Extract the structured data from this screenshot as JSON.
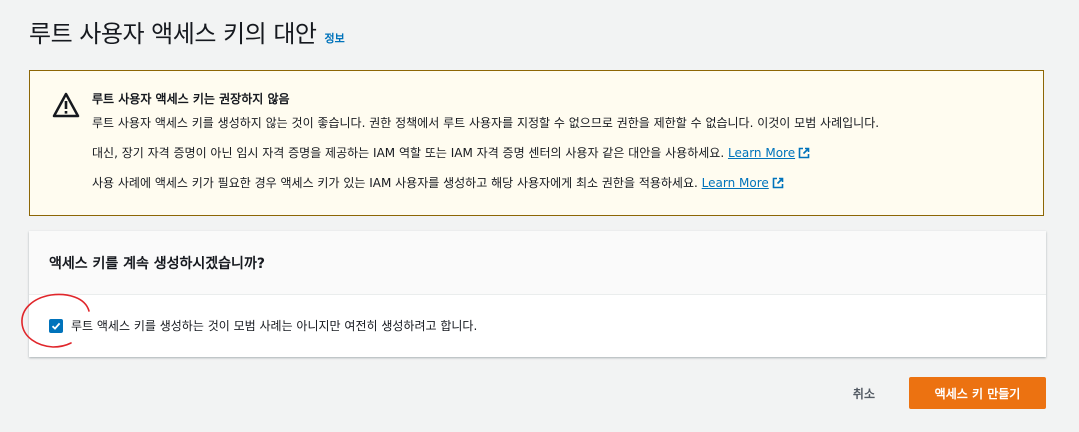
{
  "header": {
    "title": "루트 사용자 액세스 키의 대안",
    "info_link": "정보"
  },
  "warning": {
    "title": "루트 사용자 액세스 키는 권장하지 않음",
    "line1": "루트 사용자 액세스 키를 생성하지 않는 것이 좋습니다. 권한 정책에서 루트 사용자를 지정할 수 없으므로 권한을 제한할 수 없습니다. 이것이 모범 사례입니다.",
    "line2": "대신, 장기 자격 증명이 아닌 임시 자격 증명을 제공하는 IAM 역할 또는 IAM 자격 증명 센터의 사용자 같은 대안을 사용하세요.",
    "line3": "사용 사례에 액세스 키가 필요한 경우 액세스 키가 있는 IAM 사용자를 생성하고 해당 사용자에게 최소 권한을 적용하세요.",
    "learn_more": "Learn More",
    "icon": "warning-triangle-icon"
  },
  "panel": {
    "title": "액세스 키를 계속 생성하시겠습니까?",
    "checkbox_label": "루트 액세스 키를 생성하는 것이 모범 사례는 아니지만 여전히 생성하려고 합니다.",
    "checkbox_checked": true
  },
  "footer": {
    "cancel": "취소",
    "create": "액세스 키 만들기"
  },
  "colors": {
    "accent": "#0073bb",
    "primary": "#ec7211",
    "warning_border": "#8d6605",
    "warning_bg": "#fffcf0",
    "annotation": "#e0262b"
  }
}
